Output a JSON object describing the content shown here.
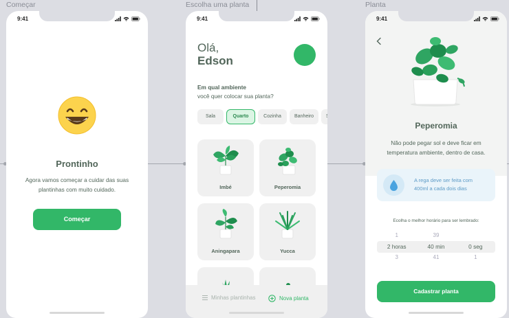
{
  "frames": {
    "start": "Começar",
    "choose": "Escolha uma planta",
    "plant": "Planta"
  },
  "status": {
    "time": "9:41"
  },
  "onboarding": {
    "emoji": "grinning-face",
    "title": "Prontinho",
    "text": "Agora vamos começar a cuidar das suas plantinhas com muito cuidado.",
    "button": "Começar"
  },
  "home": {
    "greeting": "Olá,",
    "name": "Edson",
    "question_bold": "Em qual ambiente",
    "question": "você quer colocar sua planta?",
    "environments": [
      "Sala",
      "Quarto",
      "Cozinha",
      "Banheiro",
      "S"
    ],
    "active_environment": "Quarto",
    "plants": [
      "Imbé",
      "Peperomia",
      "Aningapara",
      "Yucca"
    ],
    "tabs": {
      "my_plants": "Minhas plantinhas",
      "new_plant": "Nova planta"
    }
  },
  "detail": {
    "title": "Peperomia",
    "description": "Não pode pegar sol e deve ficar em temperatura ambiente, dentro de casa.",
    "tip": "A rega deve ser feita com 400ml a cada dois dias",
    "reminder_label": "Ecolha o melhor horário para ser lembrado:",
    "picker": {
      "above": [
        "1",
        "39",
        ""
      ],
      "selected": [
        "2 horas",
        "40 min",
        "0 seg"
      ],
      "below": [
        "3",
        "41",
        "1"
      ]
    },
    "button": "Cadastrar planta"
  },
  "colors": {
    "brand": "#32b768",
    "heading": "#52665a",
    "tip_blue": "#5c9ac6"
  }
}
